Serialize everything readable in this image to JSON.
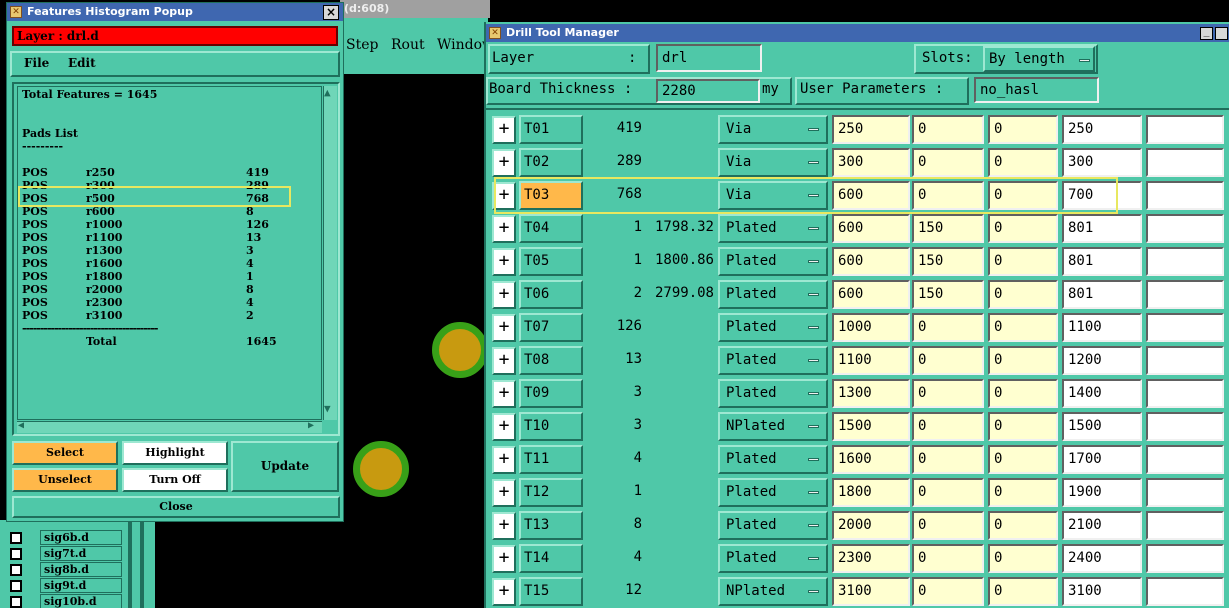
{
  "background_window": {
    "title_fragment": "d:608)",
    "menu": [
      "Step",
      "Rout",
      "Window"
    ],
    "layers": [
      "sig6b.d",
      "sig7t.d",
      "sig8b.d",
      "sig9t.d",
      "sig10b.d"
    ]
  },
  "histogram": {
    "title": "Features Histogram Popup",
    "layer_label": "Layer :  drl.d",
    "menu": {
      "file": "File",
      "edit": "Edit"
    },
    "total_line": "Total Features = 1645",
    "pads_heading": "Pads List",
    "pads_underline": "---------",
    "rows": [
      {
        "type": "POS",
        "sym": "r250",
        "count": "419"
      },
      {
        "type": "POS",
        "sym": "r300",
        "count": "289"
      },
      {
        "type": "POS",
        "sym": "r500",
        "count": "768"
      },
      {
        "type": "POS",
        "sym": "r600",
        "count": "8"
      },
      {
        "type": "POS",
        "sym": "r1000",
        "count": "126"
      },
      {
        "type": "POS",
        "sym": "r1100",
        "count": "13"
      },
      {
        "type": "POS",
        "sym": "r1300",
        "count": "3"
      },
      {
        "type": "POS",
        "sym": "r1600",
        "count": "4"
      },
      {
        "type": "POS",
        "sym": "r1800",
        "count": "1"
      },
      {
        "type": "POS",
        "sym": "r2000",
        "count": "8"
      },
      {
        "type": "POS",
        "sym": "r2300",
        "count": "4"
      },
      {
        "type": "POS",
        "sym": "r3100",
        "count": "2"
      }
    ],
    "separator": "--------------------------------------",
    "total_label": "Total",
    "total_value": "1645",
    "buttons": {
      "select": "Select",
      "unselect": "Unselect",
      "highlight": "Highlight",
      "turn_off": "Turn Off",
      "update": "Update",
      "close": "Close"
    }
  },
  "drill": {
    "title": "Drill Tool Manager",
    "layer_label": "Layer",
    "layer_colon": ":",
    "layer_value": "drl",
    "slots_label": "Slots:",
    "slots_value": "By length",
    "thickness_label": "Board Thickness :",
    "thickness_value": "2280",
    "thickness_unit": "my",
    "user_params_label": "User Parameters :",
    "user_params_value": "no_hasl",
    "tools": [
      {
        "name": "T01",
        "count": "419",
        "slot": "",
        "type": "Via",
        "f1": "250",
        "f2": "0",
        "f3": "0",
        "f4": "250"
      },
      {
        "name": "T02",
        "count": "289",
        "slot": "",
        "type": "Via",
        "f1": "300",
        "f2": "0",
        "f3": "0",
        "f4": "300"
      },
      {
        "name": "T03",
        "count": "768",
        "slot": "",
        "type": "Via",
        "f1": "600",
        "f2": "0",
        "f3": "0",
        "f4": "700"
      },
      {
        "name": "T04",
        "count": "1",
        "slot": "1798.32",
        "type": "Plated",
        "f1": "600",
        "f2": "150",
        "f3": "0",
        "f4": "801"
      },
      {
        "name": "T05",
        "count": "1",
        "slot": "1800.86",
        "type": "Plated",
        "f1": "600",
        "f2": "150",
        "f3": "0",
        "f4": "801"
      },
      {
        "name": "T06",
        "count": "2",
        "slot": "2799.08",
        "type": "Plated",
        "f1": "600",
        "f2": "150",
        "f3": "0",
        "f4": "801"
      },
      {
        "name": "T07",
        "count": "126",
        "slot": "",
        "type": "Plated",
        "f1": "1000",
        "f2": "0",
        "f3": "0",
        "f4": "1100"
      },
      {
        "name": "T08",
        "count": "13",
        "slot": "",
        "type": "Plated",
        "f1": "1100",
        "f2": "0",
        "f3": "0",
        "f4": "1200"
      },
      {
        "name": "T09",
        "count": "3",
        "slot": "",
        "type": "Plated",
        "f1": "1300",
        "f2": "0",
        "f3": "0",
        "f4": "1400"
      },
      {
        "name": "T10",
        "count": "3",
        "slot": "",
        "type": "NPlated",
        "f1": "1500",
        "f2": "0",
        "f3": "0",
        "f4": "1500"
      },
      {
        "name": "T11",
        "count": "4",
        "slot": "",
        "type": "Plated",
        "f1": "1600",
        "f2": "0",
        "f3": "0",
        "f4": "1700"
      },
      {
        "name": "T12",
        "count": "1",
        "slot": "",
        "type": "Plated",
        "f1": "1800",
        "f2": "0",
        "f3": "0",
        "f4": "1900"
      },
      {
        "name": "T13",
        "count": "8",
        "slot": "",
        "type": "Plated",
        "f1": "2000",
        "f2": "0",
        "f3": "0",
        "f4": "2100"
      },
      {
        "name": "T14",
        "count": "4",
        "slot": "",
        "type": "Plated",
        "f1": "2300",
        "f2": "0",
        "f3": "0",
        "f4": "2400"
      },
      {
        "name": "T15",
        "count": "12",
        "slot": "",
        "type": "NPlated",
        "f1": "3100",
        "f2": "0",
        "f3": "0",
        "f4": "3100"
      }
    ]
  },
  "colors": {
    "teal": "#4fc8a8",
    "red": "#ff0000",
    "orange": "#ffb84a",
    "yellow_field": "#ffffd0",
    "highlight_box": "#e8e860"
  }
}
